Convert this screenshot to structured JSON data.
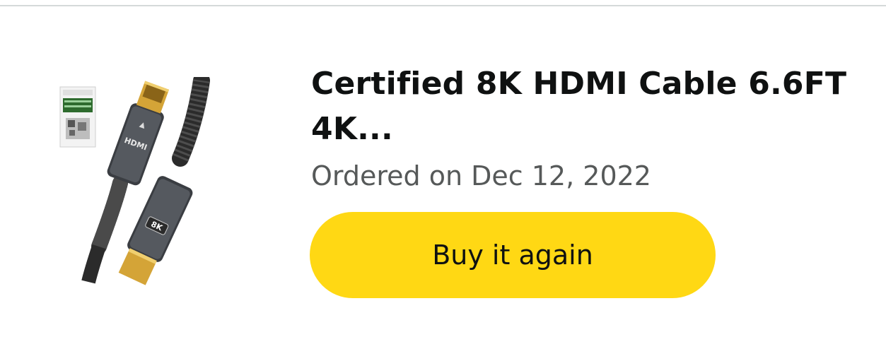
{
  "order_item": {
    "title": "Certified 8K HDMI Cable 6.6FT 4K...",
    "ordered_date": "Ordered on Dec 12, 2022",
    "buy_again_label": "Buy it again",
    "image_icon": "hdmi-cable-product-image",
    "button_color": "#ffd814"
  }
}
